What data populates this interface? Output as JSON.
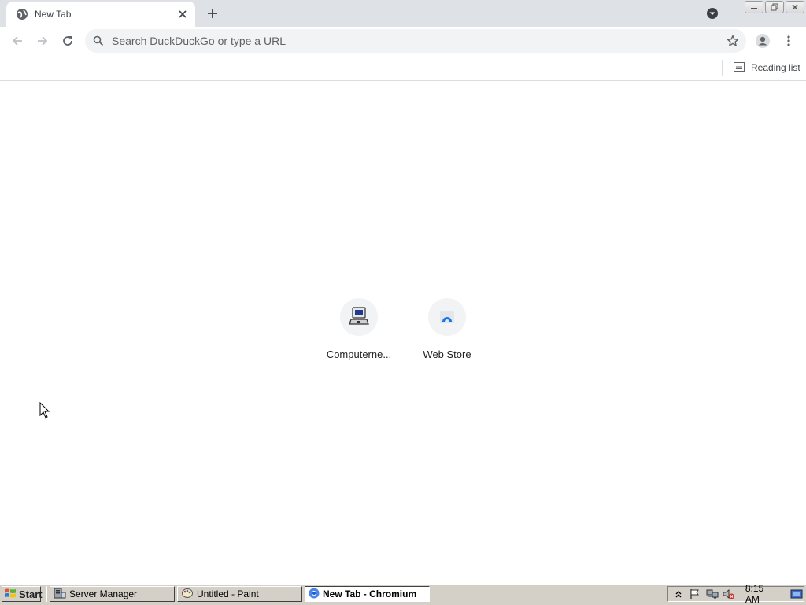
{
  "browser": {
    "tab": {
      "title": "New Tab",
      "favicon": "globe-icon"
    },
    "toolbar": {
      "omnibox_placeholder": "Search DuckDuckGo or type a URL"
    },
    "bookmarks_bar": {
      "reading_list_label": "Reading list"
    }
  },
  "new_tab_page": {
    "shortcuts": [
      {
        "label": "Computerne...",
        "icon": "computer-icon"
      },
      {
        "label": "Web Store",
        "icon": "web-store-icon"
      }
    ]
  },
  "taskbar": {
    "start_label": "Start",
    "tasks": [
      {
        "label": "Server Manager",
        "icon": "server-manager-icon",
        "active": false
      },
      {
        "label": "Untitled - Paint",
        "icon": "paint-icon",
        "active": false
      },
      {
        "label": "New Tab - Chromium",
        "icon": "chromium-icon",
        "active": true
      }
    ],
    "clock": "8:15 AM"
  },
  "colors": {
    "tabstrip_bg": "#dee1e6",
    "omnibox_bg": "#f1f3f4",
    "taskbar_bg": "#d4d0c8",
    "accent": "#1a73e8"
  }
}
